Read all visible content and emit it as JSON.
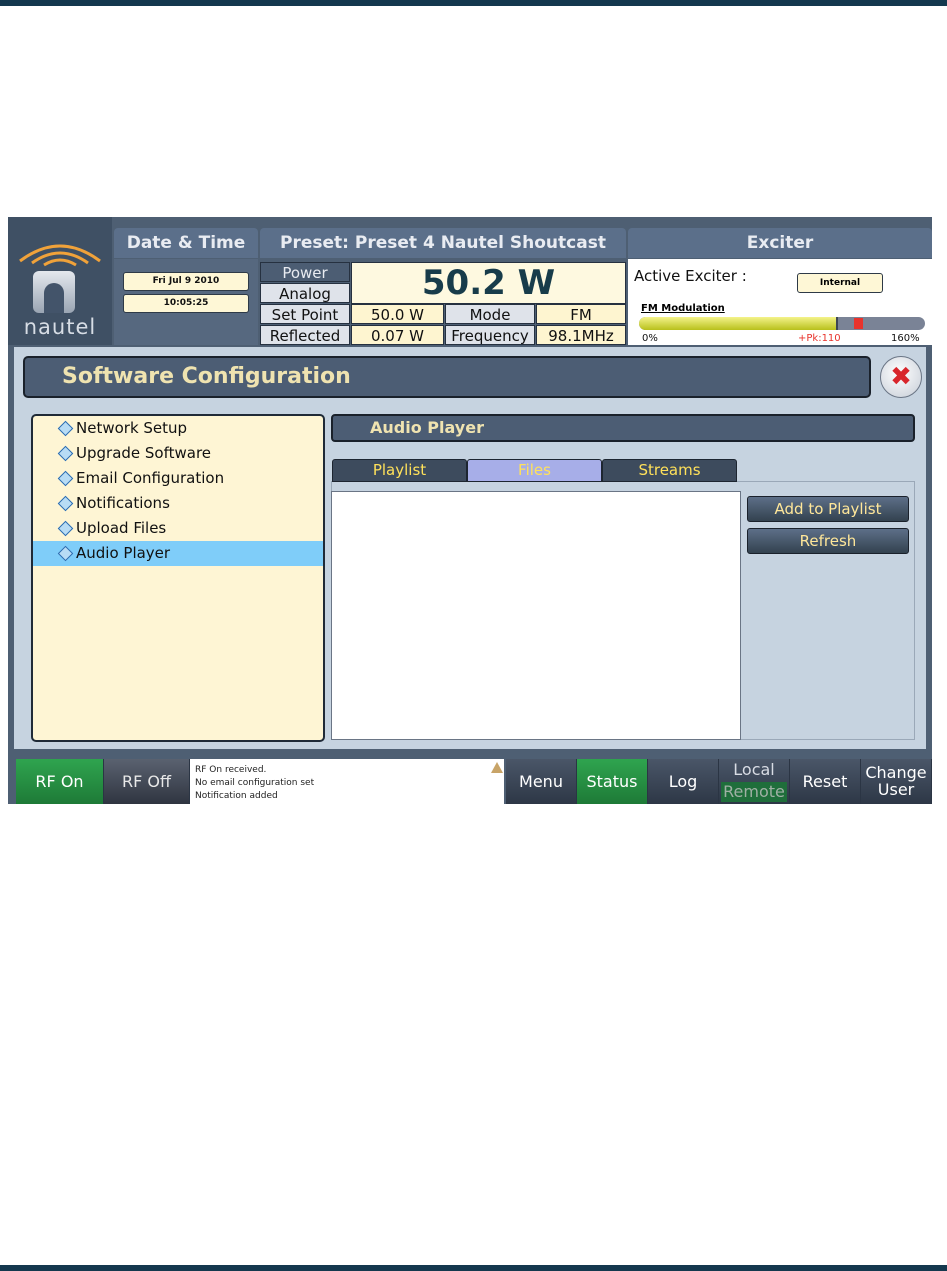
{
  "header": {
    "logo_text": "nautel",
    "datetime": {
      "title": "Date & Time",
      "date": "Fri Jul 9 2010",
      "time": "10:05:25"
    },
    "preset": {
      "prefix": "Preset:",
      "name": "Preset 4 Nautel Shoutcast"
    },
    "power": {
      "tab_power": "Power",
      "tab_analog": "Analog",
      "big_value": "50.2 W",
      "setpoint_label": "Set Point",
      "setpoint_value": "50.0 W",
      "mode_label": "Mode",
      "mode_value": "FM",
      "reflected_label": "Reflected",
      "reflected_value": "0.07 W",
      "frequency_label": "Frequency",
      "frequency_value": "98.1MHz"
    },
    "exciter": {
      "title": "Exciter",
      "active_label": "Active Exciter :",
      "active_value": "Internal",
      "fm_label": "FM Modulation",
      "fm_level_percent": 110,
      "fm_peak_percent": 110,
      "fm_min_label": "0%",
      "fm_peak_label": "+Pk:110",
      "fm_max_label": "160%"
    }
  },
  "window": {
    "title": "Software Configuration",
    "close_icon": "close-x-icon",
    "nav_items": [
      {
        "label": "Network Setup",
        "selected": false
      },
      {
        "label": "Upgrade Software",
        "selected": false
      },
      {
        "label": "Email Configuration",
        "selected": false
      },
      {
        "label": "Notifications",
        "selected": false
      },
      {
        "label": "Upload Files",
        "selected": false
      },
      {
        "label": "Audio Player",
        "selected": true
      }
    ],
    "section_title": "Audio Player",
    "tabs": [
      {
        "label": "Playlist",
        "active": false
      },
      {
        "label": "Files",
        "active": true
      },
      {
        "label": "Streams",
        "active": false
      }
    ],
    "buttons": {
      "add_to_playlist": "Add to Playlist",
      "refresh": "Refresh"
    }
  },
  "bottom_bar": {
    "rf_on": "RF On",
    "rf_off": "RF Off",
    "messages": [
      "RF On received.",
      "No email configuration set",
      "Notification added"
    ],
    "menu": "Menu",
    "status": "Status",
    "log": "Log",
    "local": "Local",
    "remote": "Remote",
    "reset": "Reset",
    "change_user": [
      "Change",
      "User"
    ]
  },
  "colors": {
    "accent_green": "#2fa44f",
    "panel_blue": "#4c5d74",
    "highlight": "#7fcdf9",
    "alarm_red": "#e8332c"
  }
}
